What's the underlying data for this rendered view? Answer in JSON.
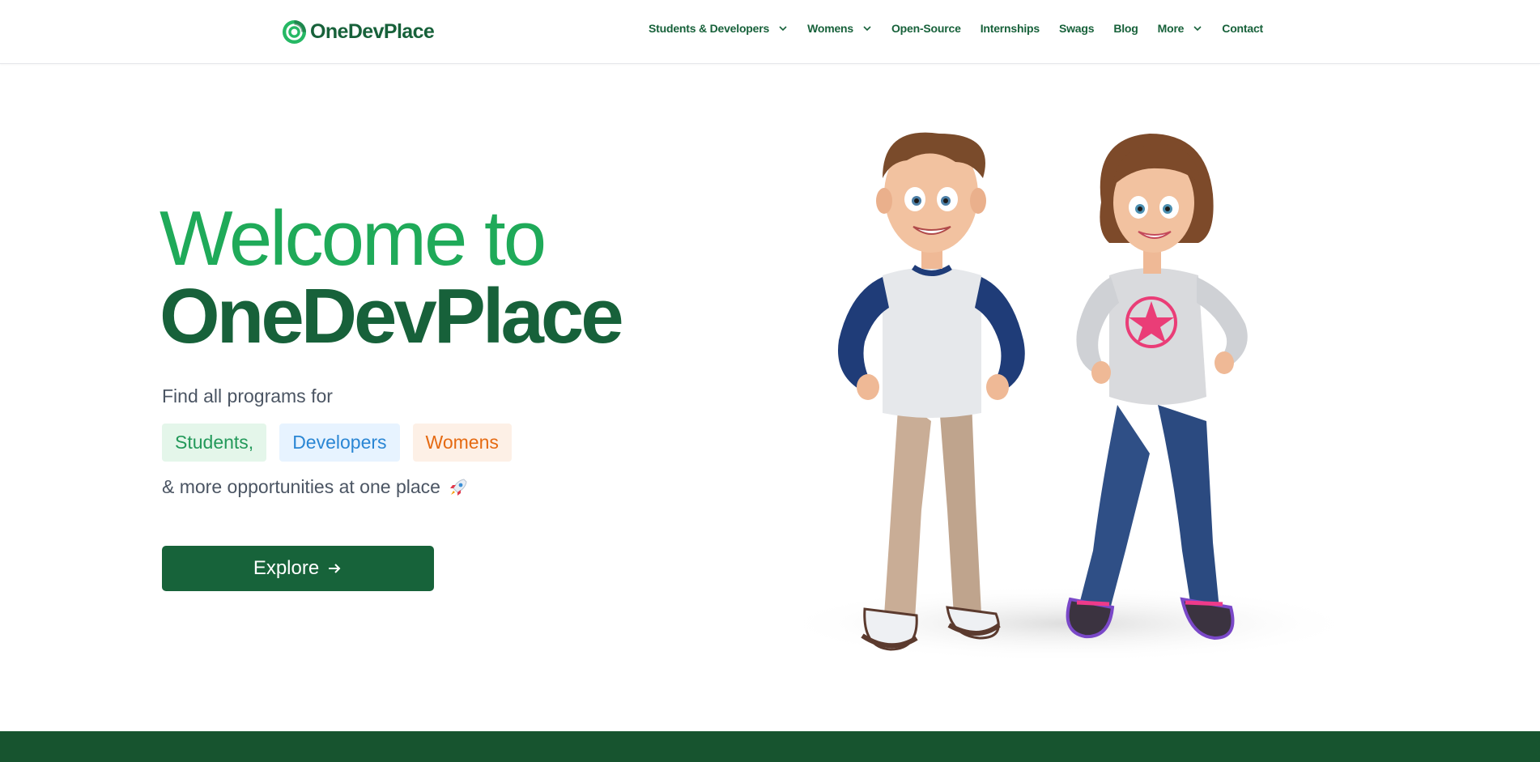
{
  "brand": {
    "name": "OneDevPlace",
    "logo_icon": "target-ring-icon",
    "color": "#17613a"
  },
  "nav": {
    "items": [
      {
        "label": "Students & Developers",
        "dropdown": true
      },
      {
        "label": "Womens",
        "dropdown": true
      },
      {
        "label": "Open-Source",
        "dropdown": false
      },
      {
        "label": "Internships",
        "dropdown": false
      },
      {
        "label": "Swags",
        "dropdown": false
      },
      {
        "label": "Blog",
        "dropdown": false
      },
      {
        "label": "More",
        "dropdown": true
      },
      {
        "label": "Contact",
        "dropdown": false
      }
    ]
  },
  "hero": {
    "title_line1": "Welcome to",
    "title_line2": "OneDevPlace",
    "subtitle": "Find all programs for",
    "chips": [
      "Students,",
      "Developers",
      "Womens"
    ],
    "more_text": "& more opportunities at one place",
    "more_icon": "rocket-icon",
    "cta_label": "Explore",
    "cta_icon": "arrow-right-icon"
  },
  "colors": {
    "accent_green": "#1faa59",
    "dark_green": "#17613a",
    "chip_students": "#e4f6ea",
    "chip_developers": "#e7f3ff",
    "chip_womens": "#fdf0e6",
    "footer_band": "#17542f"
  }
}
